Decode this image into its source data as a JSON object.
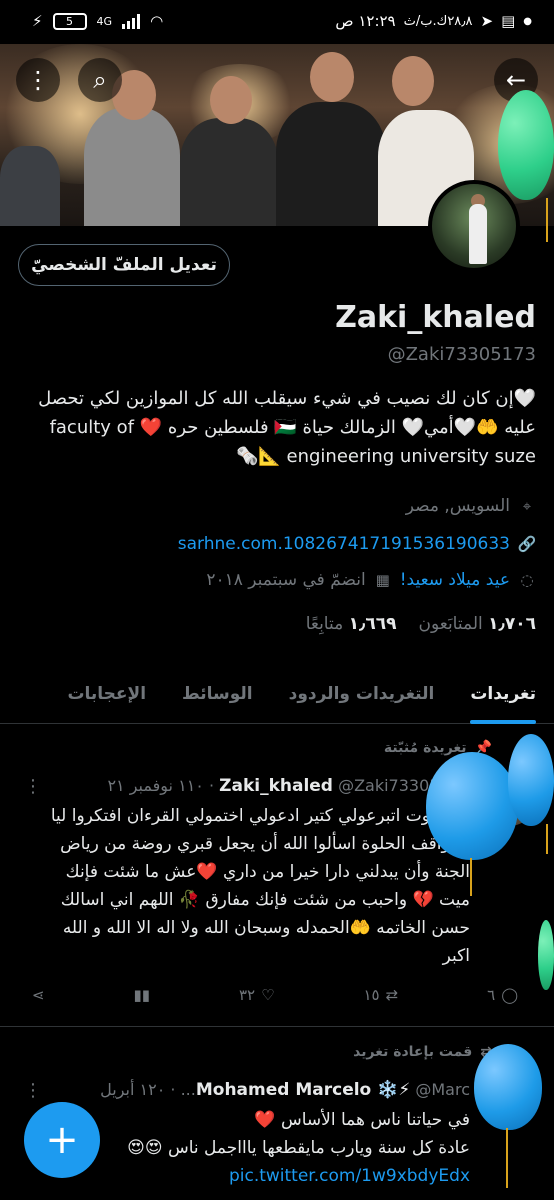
{
  "status_bar": {
    "time": "١٢:٢٩ ص",
    "speed": "٢٨٫٨ك.ب/ث",
    "battery": "5"
  },
  "header": {
    "back_icon": "arrow-right-icon",
    "search_icon": "search-icon",
    "more_icon": "more-vertical-icon"
  },
  "profile": {
    "edit_button": "تعديل الملفّ الشخصيّ",
    "name": "Zaki_khaled",
    "handle": "@Zaki73305173",
    "bio_line1": "🤍إن كان لك نصيب في شيء سيقلب الله كل الموازين لكي تحصل",
    "bio_line2": "عليه 🤲🤍أمي🤍 الزمالك حياة 🇵🇸 فلسطين حره ❤️ faculty of",
    "bio_line3": "engineering university suze 📐🗞️",
    "location": "السويس, مصر",
    "website": "1082674171915361906 33.sarhne.com",
    "birthday": "عيد ميلاد سعيد!",
    "joined": "انضمّ في سبتمبر ٢٠١٨",
    "followers_count": "١٫٧٠٦",
    "followers_label": "المتابَعون",
    "following_count": "١٫٦٦٩",
    "following_label": "متابِعًا"
  },
  "tabs": [
    {
      "label": "تغريدات",
      "active": true
    },
    {
      "label": "التغريدات والردود",
      "active": false
    },
    {
      "label": "الوسائط",
      "active": false
    },
    {
      "label": "الإعجابات",
      "active": false
    }
  ],
  "tweets": [
    {
      "context": "تغريدة مُثبّتة",
      "author": "Zaki_khaled",
      "handle": "@Zaki73305173",
      "date": "١١٠ نوفمبر ٢١",
      "lines": [
        "لما اموت اتبرعولي كتير ادعولي اختمولي القرءان افتكروا ليا",
        "المواقف الحلوة اسألوا الله أن يجعل قبري روضة من رياض",
        "الجنة وأن يبدلني دارا خيرا من داري ❤️عش ما شئت فإنك",
        "ميت 💔 واحبب من شئت فإنك مفارق 🥀 اللهم اني اسالك",
        "حسن الخاتمه 🤲الحمدله وسبحان الله ولا اله الا الله و الله",
        "اكبر"
      ],
      "replies": "٦",
      "retweets": "١٥",
      "likes": "٣٢",
      "views": ""
    },
    {
      "context": "قمت بإعادة تغريد",
      "author": "Mohamed Marcelo ❄️⚡",
      "handle": "@Marc...",
      "date": "١٢٠ أبريل",
      "lines": [
        "في حياتنا ناس هما الأساس ❤️",
        "عادة كل سنة ويارب مايقطعها ياااجمل ناس 😍😍",
        "pic.twitter.com/1w9xbdyEdx"
      ]
    }
  ],
  "fab": {
    "label": "+",
    "icon": "compose-plus-icon"
  },
  "colors": {
    "accent": "#1d9bf0",
    "background": "#000000",
    "muted": "#71767b",
    "balloon_blue": "#1e9be8",
    "balloon_green": "#2ecf8a"
  }
}
